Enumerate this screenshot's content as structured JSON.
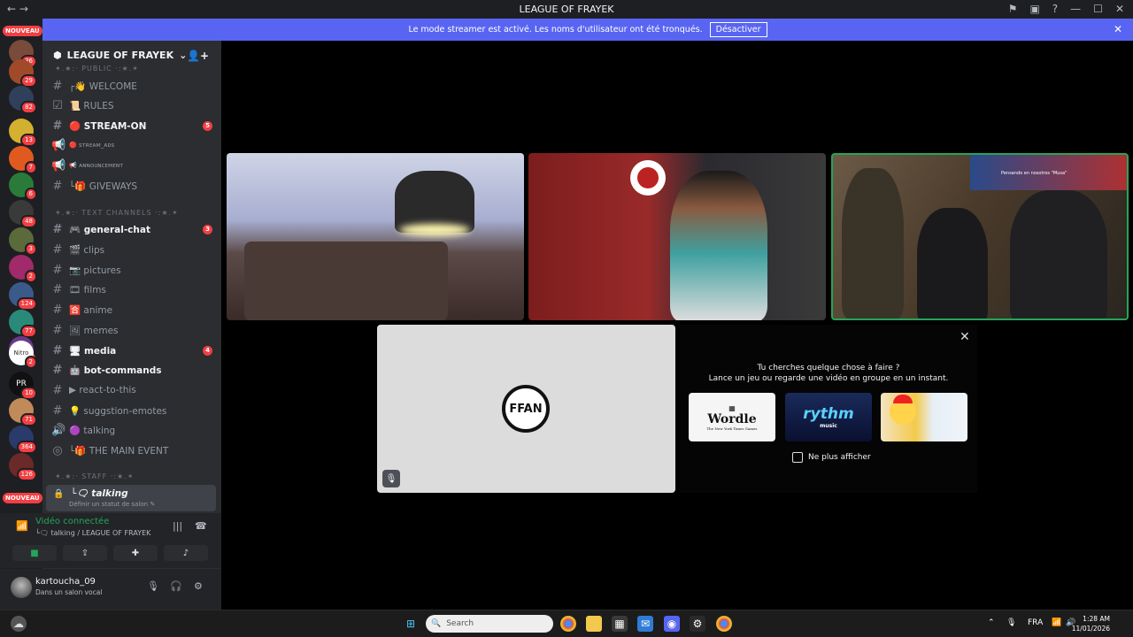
{
  "window": {
    "title": "LEAGUE OF FRAYEK"
  },
  "banner": {
    "message": "Le mode streamer est activé. Les noms d'utilisateur ont été tronqués.",
    "button": "Désactiver"
  },
  "servers": {
    "nouveau_top": "NOUVEAU",
    "nouveau_bottom": "NOUVEAU",
    "badges": [
      "36",
      "29",
      "82",
      "13",
      "7",
      "6",
      "48",
      "3",
      "2",
      "124",
      "77",
      "147",
      "2",
      "10",
      "71",
      "364",
      "126"
    ],
    "labels": {
      "s10": "Nitro",
      "s13": "PR"
    }
  },
  "guild": {
    "name": "LEAGUE OF FRAYEK",
    "categories": [
      "✶.★:· PUBLIC ·:★.✶",
      "✶.★:· TEXT CHANNELS ·:★.✶",
      "✶.★:· STAFF ·:★.✶"
    ],
    "channels": [
      {
        "name": "┌👋 WELCOME",
        "unread": ""
      },
      {
        "name": "📜 RULES",
        "unread": ""
      },
      {
        "name": "🔴 STREAM-ON",
        "unread": "5"
      },
      {
        "name": "🔴 ꜱᴛʀᴇᴀᴍ_ᴀᴅꜱ",
        "unread": ""
      },
      {
        "name": "📢 ᴀɴɴᴏᴜɴᴄᴇᴍᴇɴᴛ",
        "unread": ""
      },
      {
        "name": "└🎁 GIVEWAYS",
        "unread": ""
      },
      {
        "name": "🎮 general-chat",
        "unread": "3"
      },
      {
        "name": "🎬 clips",
        "unread": ""
      },
      {
        "name": "📷 pictures",
        "unread": ""
      },
      {
        "name": "🎞 films",
        "unread": ""
      },
      {
        "name": "🈴 anime",
        "unread": ""
      },
      {
        "name": "🖼 memes",
        "unread": ""
      },
      {
        "name": "🖥 media",
        "unread": "4"
      },
      {
        "name": "🤖 bot-commands",
        "unread": ""
      },
      {
        "name": "▶ react-to-this",
        "unread": ""
      },
      {
        "name": "💡 suggstion-emotes",
        "unread": ""
      },
      {
        "name": "🟣 talking",
        "unread": ""
      },
      {
        "name": "└🎁 THE MAIN EVENT",
        "unread": ""
      }
    ],
    "active_channel": {
      "name": "└🗨 talking",
      "status": "Définir un statut de salon ✎"
    }
  },
  "voice": {
    "connected": "Vidéo connectée",
    "location": "└🗨 talking / LEAGUE OF FRAYEK"
  },
  "user": {
    "name": "kartoucha_09",
    "status": "Dans un salon vocal"
  },
  "stage": {
    "tile4_logo": "FFAN",
    "activity": {
      "question": "Tu cherches quelque chose à faire ?",
      "hint": "Lance un jeu ou regarde une vidéo en groupe en un instant.",
      "cards": [
        "Wordle",
        "rythm",
        ""
      ],
      "wordle_sub": "The New York Times Games",
      "rythm_sub": "music",
      "checkbox": "Ne plus afficher"
    },
    "tile3_caption": "Pensando en nosotros \"Musa\""
  },
  "taskbar": {
    "search": "Search",
    "lang": "FRA",
    "time": "1:28 AM",
    "date": "11/01/2026"
  },
  "colors": {
    "accent": "#5865f2",
    "green": "#23a55a",
    "red": "#f23f43"
  }
}
